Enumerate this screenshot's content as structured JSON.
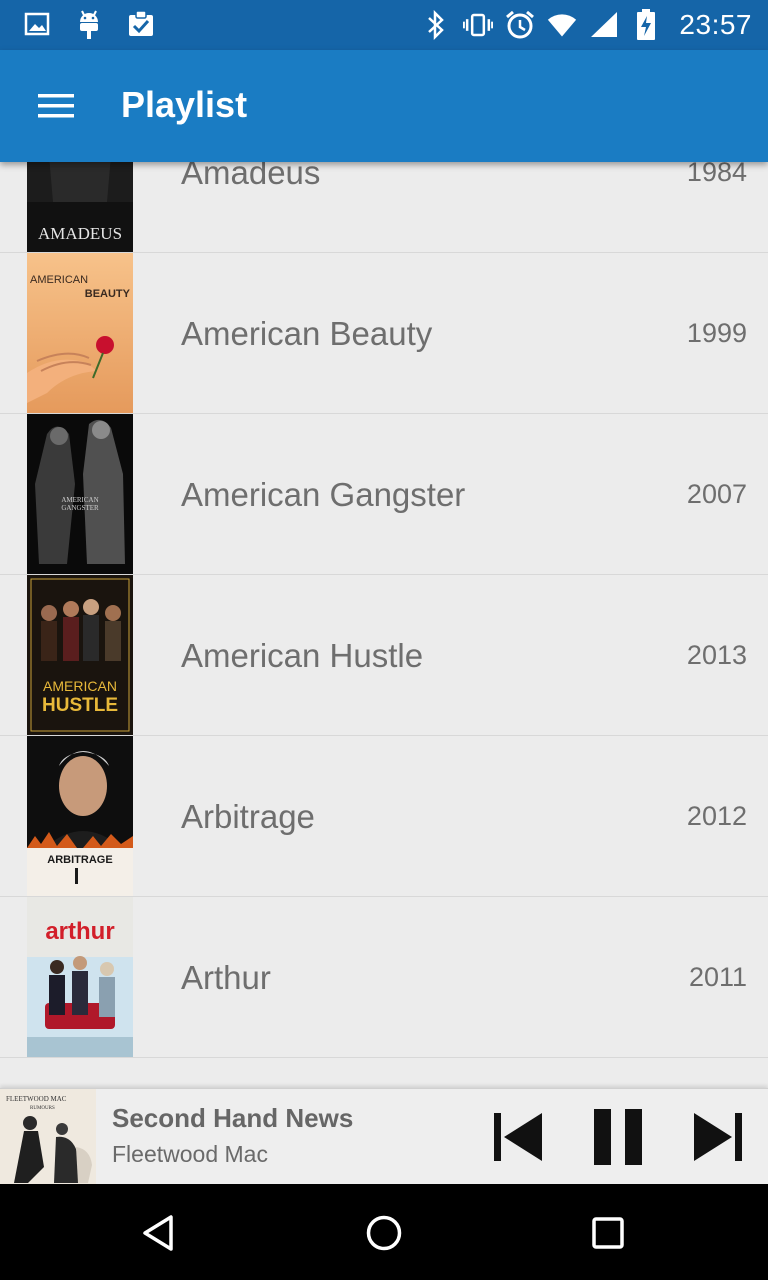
{
  "status_bar": {
    "time": "23:57",
    "left_icons": [
      "image-icon",
      "android-icon",
      "clipboard-check-icon"
    ],
    "right_icons": [
      "bluetooth-icon",
      "vibrate-icon",
      "alarm-icon",
      "wifi-icon",
      "cell-signal-icon",
      "battery-charging-icon"
    ]
  },
  "app_bar": {
    "title": "Playlist",
    "menu_icon": "menu-icon",
    "color": "#1a7cc3"
  },
  "playlist": [
    {
      "title": "Amadeus",
      "year": "1984",
      "poster_text": "AMADEUS"
    },
    {
      "title": "American Beauty",
      "year": "1999",
      "poster_text": "AMERICAN BEAUTY"
    },
    {
      "title": "American Gangster",
      "year": "2007",
      "poster_text": "AMERICAN GANGSTER"
    },
    {
      "title": "American Hustle",
      "year": "2013",
      "poster_text": "AMERICAN HUSTLE"
    },
    {
      "title": "Arbitrage",
      "year": "2012",
      "poster_text": "ARBITRAGE"
    },
    {
      "title": "Arthur",
      "year": "2011",
      "poster_text": "arthur"
    }
  ],
  "now_playing": {
    "track": "Second Hand News",
    "artist": "Fleetwood Mac",
    "album_text": "FLEETWOOD MAC RUMOURS",
    "controls": [
      "skip-previous-icon",
      "pause-icon",
      "skip-next-icon"
    ]
  },
  "nav_bar": {
    "buttons": [
      "back-icon",
      "home-icon",
      "recents-icon"
    ]
  }
}
